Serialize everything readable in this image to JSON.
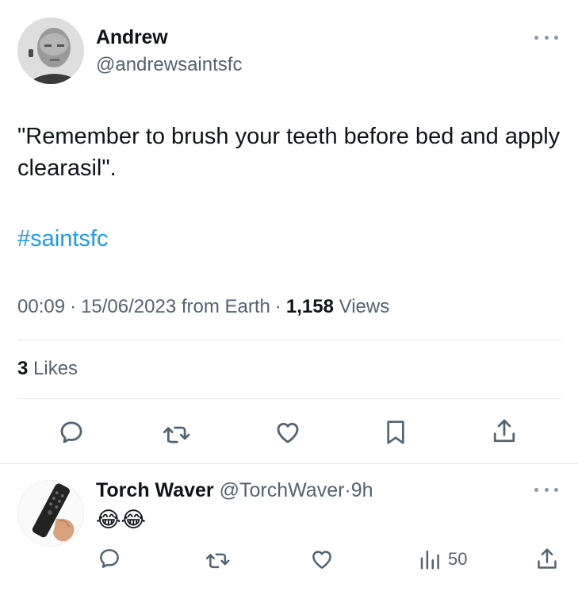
{
  "tweet": {
    "author_name": "Andrew",
    "author_handle": "@andrewsaintsfc",
    "text": "\"Remember to brush your teeth before bed and apply clearasil\".",
    "hashtag": "#saintsfc",
    "time": "00:09",
    "date": "15/06/2023",
    "location": "from Earth",
    "separator": "·",
    "views_count": "1,158",
    "views_label": "Views",
    "likes_count": "3",
    "likes_label": "Likes"
  },
  "reply": {
    "author_name": "Torch Waver",
    "author_handle": "@TorchWaver",
    "separator": "·",
    "age": "9h",
    "text": "😂😂",
    "views_count": "50"
  },
  "icons": {
    "reply": "reply-icon",
    "retweet": "retweet-icon",
    "like": "heart-icon",
    "bookmark": "bookmark-icon",
    "share": "share-icon",
    "views": "views-icon",
    "more": "more-icon"
  },
  "colors": {
    "text_primary": "#0f1419",
    "text_secondary": "#536471",
    "link": "#1d9bf0",
    "divider": "#e6e9ec"
  }
}
